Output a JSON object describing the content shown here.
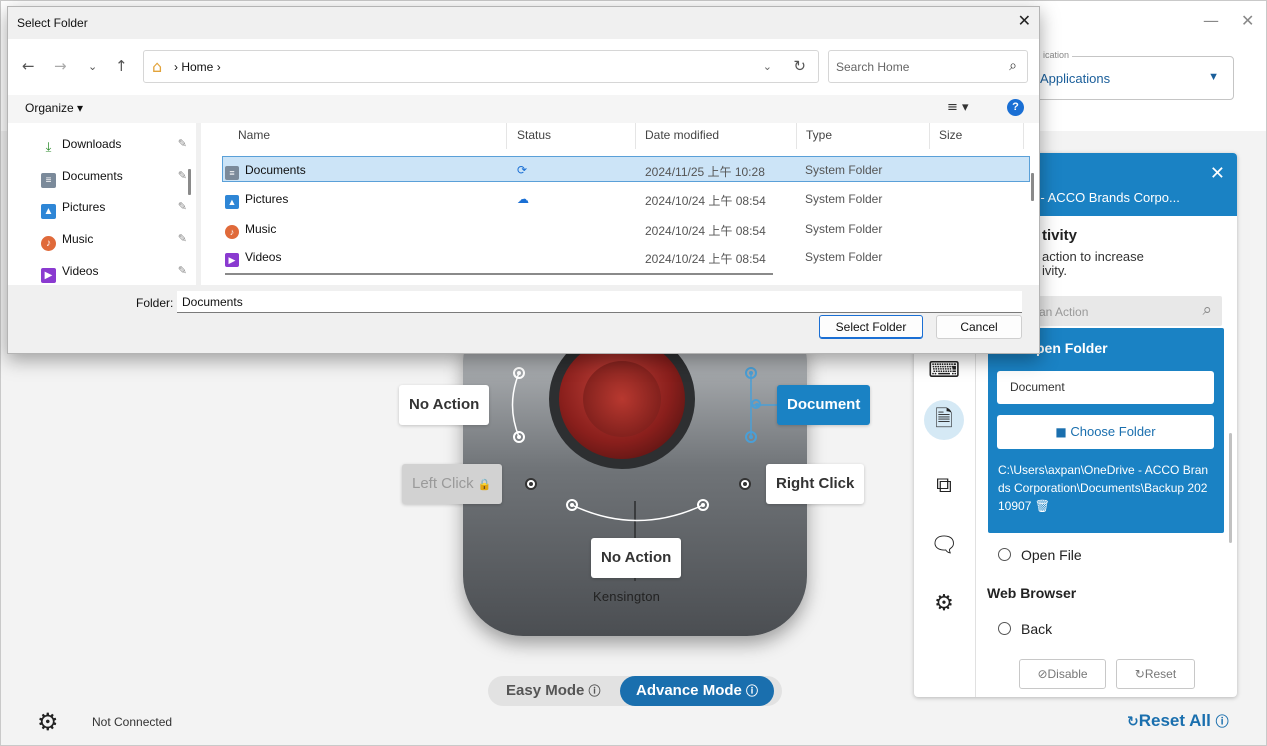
{
  "app": {
    "window_min": "—",
    "window_close": "✕",
    "top_select": {
      "label": "ication",
      "value": "Applications"
    },
    "callouts": {
      "top_left": "No Action",
      "top_right": "Document",
      "left_click": "Left Click",
      "right_click": "Right Click",
      "bottom": "No Action"
    },
    "device_brand": "Kensington",
    "modes": {
      "easy": "Easy Mode",
      "advance": "Advance Mode",
      "active": "advance"
    },
    "footer": {
      "status": "Not Connected",
      "reset_all": "Reset All"
    },
    "panel": {
      "header_title": "neDrive - ACCO Brands Corpo...",
      "section_title": "tivity",
      "description": "action to increase\nivity.",
      "search_placeholder": "an Action",
      "card": {
        "title": "pen Folder",
        "document_field": "Document",
        "choose_button": "Choose Folder",
        "path": "C:\\Users\\axpan\\OneDrive - ACCO Brands Corporation\\Documents\\Backup 20210907"
      },
      "option_open_file": "Open File",
      "group_web_browser": "Web Browser",
      "option_back": "Back",
      "disable_button": "Disable",
      "reset_button": "Reset",
      "accent_color": "#1a82c4"
    }
  },
  "dialog": {
    "title": "Select Folder",
    "breadcrumb": "Home",
    "search_placeholder": "Search Home",
    "organize": "Organize",
    "nav_items": [
      {
        "label": "Downloads",
        "icon": "download-icon"
      },
      {
        "label": "Documents",
        "icon": "documents-icon"
      },
      {
        "label": "Pictures",
        "icon": "pictures-icon"
      },
      {
        "label": "Music",
        "icon": "music-icon"
      },
      {
        "label": "Videos",
        "icon": "videos-icon"
      }
    ],
    "columns": [
      "Name",
      "Status",
      "Date modified",
      "Type",
      "Size"
    ],
    "rows": [
      {
        "name": "Documents",
        "status": "sync",
        "date": "2024/11/25 上午 10:28",
        "type": "System Folder",
        "selected": true
      },
      {
        "name": "Pictures",
        "status": "cloud",
        "date": "2024/10/24 上午 08:54",
        "type": "System Folder",
        "selected": false
      },
      {
        "name": "Music",
        "status": "",
        "date": "2024/10/24 上午 08:54",
        "type": "System Folder",
        "selected": false
      },
      {
        "name": "Videos",
        "status": "",
        "date": "2024/10/24 上午 08:54",
        "type": "System Folder",
        "selected": false
      }
    ],
    "folder_label": "Folder:",
    "folder_value": "Documents",
    "select_button": "Select Folder",
    "cancel_button": "Cancel"
  }
}
